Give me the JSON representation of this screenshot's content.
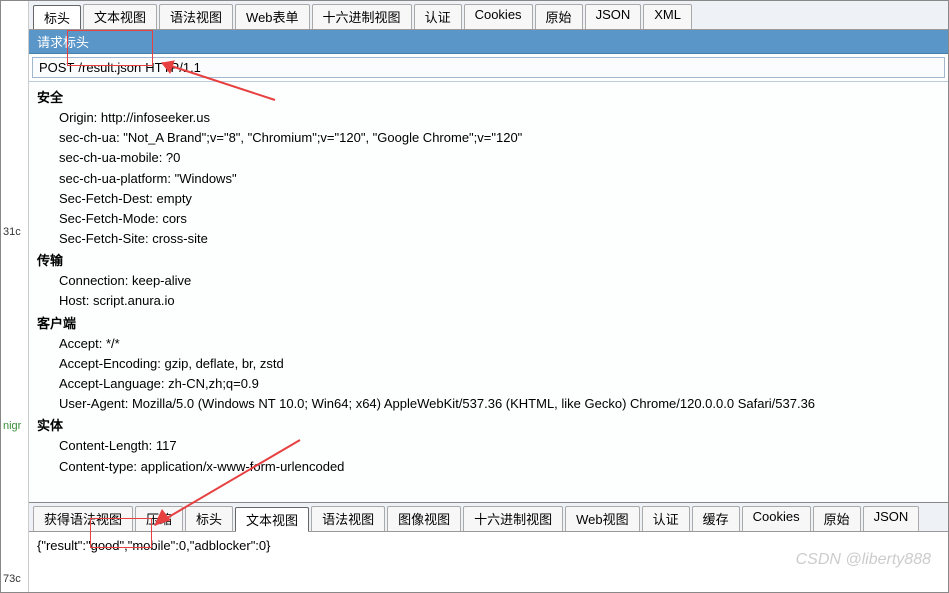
{
  "topTabs": {
    "headers": "标头",
    "textView": "文本视图",
    "syntaxView": "语法视图",
    "webForms": "Web表单",
    "hexView": "十六进制视图",
    "auth": "认证",
    "cookies": "Cookies",
    "raw": "原始",
    "json": "JSON",
    "xml": "XML"
  },
  "panel": {
    "requestHeadersTitle": "请求标头"
  },
  "requestLine": {
    "method": "POST",
    "path": "/result.json",
    "protocol": "HTTP/1.1"
  },
  "headers": {
    "security": {
      "group": "安全",
      "origin": "Origin: http://infoseeker.us",
      "ua": "sec-ch-ua: \"Not_A Brand\";v=\"8\", \"Chromium\";v=\"120\", \"Google Chrome\";v=\"120\"",
      "uaMobile": "sec-ch-ua-mobile: ?0",
      "uaPlatform": "sec-ch-ua-platform: \"Windows\"",
      "fetchDest": "Sec-Fetch-Dest: empty",
      "fetchMode": "Sec-Fetch-Mode: cors",
      "fetchSite": "Sec-Fetch-Site: cross-site"
    },
    "transport": {
      "group": "传输",
      "connection": "Connection: keep-alive",
      "host": "Host: script.anura.io"
    },
    "client": {
      "group": "客户端",
      "accept": "Accept: */*",
      "acceptEnc": "Accept-Encoding: gzip, deflate, br, zstd",
      "acceptLang": "Accept-Language: zh-CN,zh;q=0.9",
      "userAgent": "User-Agent: Mozilla/5.0 (Windows NT 10.0; Win64; x64) AppleWebKit/537.36 (KHTML, like Gecko) Chrome/120.0.0.0 Safari/537.36"
    },
    "entity": {
      "group": "实体",
      "contentLength": "Content-Length: 117",
      "contentType": "Content-type: application/x-www-form-urlencoded"
    }
  },
  "bottomTabs": {
    "getSyntaxView": "获得语法视图",
    "compress": "压缩",
    "headers": "标头",
    "textView": "文本视图",
    "syntaxView": "语法视图",
    "imageView": "图像视图",
    "hexView": "十六进制视图",
    "webView": "Web视图",
    "auth": "认证",
    "cache": "缓存",
    "cookies": "Cookies",
    "raw": "原始",
    "json": "JSON"
  },
  "responseBody": "{\"result\":\"good\",\"mobile\":0,\"adblocker\":0}",
  "leftMarks": {
    "m1": "31c",
    "m2": "nigr",
    "m3": "73c"
  },
  "watermark": "CSDN @liberty888"
}
